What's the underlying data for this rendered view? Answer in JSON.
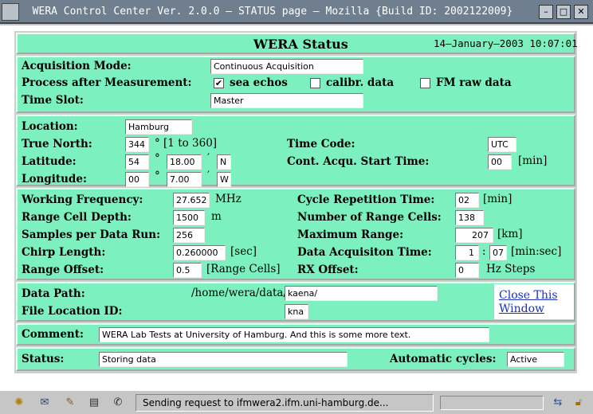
{
  "window": {
    "title": "WERA Control Center Ver. 2.0.0 – STATUS page – Mozilla {Build ID: 2002122009}",
    "min_glyph": "–",
    "max_glyph": "□",
    "close_glyph": "✕"
  },
  "header": {
    "title": "WERA Status",
    "datetime": "14–January–2003 10:07:01"
  },
  "acquisition": {
    "mode_label": "Acquisition Mode:",
    "mode_value": "Continuous Acquisition",
    "process_label": "Process after Measurement:",
    "sea_echos_label": "sea echos",
    "sea_echos_checked": true,
    "calibr_label": "calibr. data",
    "calibr_checked": false,
    "fm_raw_label": "FM raw data",
    "fm_raw_checked": false,
    "check_mark": "✔",
    "time_slot_label": "Time Slot:",
    "time_slot_value": "Master"
  },
  "location": {
    "location_label": "Location:",
    "location_value": "Hamburg",
    "true_north_label": "True North:",
    "true_north_value": "344",
    "true_north_unit": "° [1 to 360]",
    "latitude_label": "Latitude:",
    "lat_deg": "54",
    "lat_min": "18.00",
    "lat_hem": "N",
    "longitude_label": "Longitude:",
    "lon_deg": "00",
    "lon_min": "7.00",
    "lon_hem": "W",
    "deg_symbol": "°",
    "min_symbol": "′",
    "time_code_label": "Time Code:",
    "time_code_value": "UTC",
    "start_time_label": "Cont. Acqu. Start Time:",
    "start_time_value": "00",
    "start_time_unit": "[min]"
  },
  "radar": {
    "freq_label": "Working Frequency:",
    "freq_value": "27.652",
    "freq_unit": "MHz",
    "cell_depth_label": "Range Cell Depth:",
    "cell_depth_value": "1500",
    "cell_depth_unit": "m",
    "samples_label": "Samples per Data Run:",
    "samples_value": "256",
    "chirp_label": "Chirp Length:",
    "chirp_value": "0.260000",
    "chirp_unit": "[sec]",
    "range_offset_label": "Range Offset:",
    "range_offset_value": "0.5",
    "range_offset_unit": "[Range Cells]",
    "cycle_label": "Cycle Repetition Time:",
    "cycle_value": "02",
    "cycle_unit": "[min]",
    "num_cells_label": "Number of Range Cells:",
    "num_cells_value": "138",
    "max_range_label": "Maximum Range:",
    "max_range_value": "207",
    "max_range_unit": "[km]",
    "acq_time_label": "Data Acquisiton Time:",
    "acq_time_min": "1",
    "acq_time_sep": ":",
    "acq_time_sec": "07",
    "acq_time_unit": "[min:sec]",
    "rx_offset_label": "RX Offset:",
    "rx_offset_value": "0",
    "rx_offset_unit": "Hz Steps"
  },
  "paths": {
    "data_path_label": "Data Path:",
    "data_path_prefix": "/home/wera/data/",
    "data_path_value": "kaena/",
    "file_location_label": "File Location ID:",
    "file_location_value": "kna",
    "close_link_line1": "Close This",
    "close_link_line2": "Window"
  },
  "comment": {
    "label": "Comment:",
    "value": "WERA Lab Tests at University of Hamburg. And this is some more text."
  },
  "status": {
    "label": "Status:",
    "value": "Storing data",
    "auto_label": "Automatic cycles:",
    "auto_value": "Active"
  },
  "statusbar": {
    "message": "Sending request to ifmwera2.ifm.uni-hamburg.de...",
    "icons": [
      "navigator-icon",
      "mail-icon",
      "composer-icon",
      "addressbook-icon",
      "irc-icon"
    ]
  },
  "colors": {
    "panel": "#7df0c0",
    "titlebar": "#6f7f8f",
    "link": "#1a30c0"
  }
}
